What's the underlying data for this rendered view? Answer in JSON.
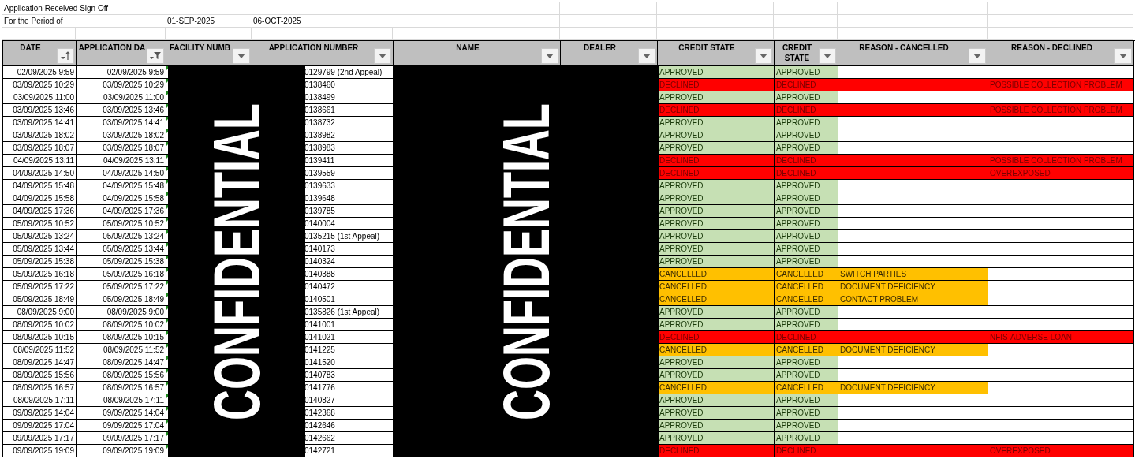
{
  "title": "Application Received Sign Off",
  "period": {
    "label": "For the Period of",
    "from": "01-SEP-2025",
    "to": "06-OCT-2025"
  },
  "columns": [
    {
      "label": "DATE",
      "kind": "sort"
    },
    {
      "label": "APPLICATION DA",
      "kind": "filter"
    },
    {
      "label": "FACILITY NUMB",
      "kind": "dropdown"
    },
    {
      "label": "APPLICATION NUMBER",
      "kind": "dropdown"
    },
    {
      "label": "NAME",
      "kind": "dropdown"
    },
    {
      "label": "DEALER",
      "kind": "dropdown"
    },
    {
      "label": "CREDIT STATE",
      "kind": "dropdown"
    },
    {
      "label": "CREDIT STATE",
      "kind": "dropdown"
    },
    {
      "label": "REASON  - CANCELLED",
      "kind": "dropdown"
    },
    {
      "label": "REASON - DECLINED",
      "kind": "dropdown"
    }
  ],
  "redactions": [
    "CONFIDENTIAL",
    "CONFIDENTIAL"
  ],
  "rows": [
    {
      "date": "02/09/2025 9:59",
      "application_date": "02/09/2025 9:59",
      "application_number": "0129799 (2nd Appeal)",
      "kind": "approved",
      "credit_state": "APPROVED",
      "credit_state_2": "APPROVED",
      "reason_cancelled": "",
      "reason_declined": ""
    },
    {
      "date": "03/09/2025 10:29",
      "application_date": "03/09/2025 10:29",
      "application_number": "0138460",
      "kind": "declined",
      "credit_state": "DECLINED",
      "credit_state_2": "DECLINED",
      "reason_cancelled": "",
      "reason_declined": "POSSIBLE COLLECTION PROBLEM"
    },
    {
      "date": "03/09/2025 11:00",
      "application_date": "03/09/2025 11:00",
      "application_number": "0138499",
      "kind": "approved",
      "credit_state": "APPROVED",
      "credit_state_2": "APPROVED",
      "reason_cancelled": "",
      "reason_declined": ""
    },
    {
      "date": "03/09/2025 13:46",
      "application_date": "03/09/2025 13:46",
      "application_number": "0138661",
      "kind": "declined",
      "credit_state": "DECLINED",
      "credit_state_2": "DECLINED",
      "reason_cancelled": "",
      "reason_declined": "POSSIBLE COLLECTION PROBLEM"
    },
    {
      "date": "03/09/2025 14:41",
      "application_date": "03/09/2025 14:41",
      "application_number": "0138732",
      "kind": "approved",
      "credit_state": "APPROVED",
      "credit_state_2": "APPROVED",
      "reason_cancelled": "",
      "reason_declined": ""
    },
    {
      "date": "03/09/2025 18:02",
      "application_date": "03/09/2025 18:02",
      "application_number": "0138982",
      "kind": "approved",
      "credit_state": "APPROVED",
      "credit_state_2": "APPROVED",
      "reason_cancelled": "",
      "reason_declined": ""
    },
    {
      "date": "03/09/2025 18:07",
      "application_date": "03/09/2025 18:07",
      "application_number": "0138983",
      "kind": "approved",
      "credit_state": "APPROVED",
      "credit_state_2": "APPROVED",
      "reason_cancelled": "",
      "reason_declined": ""
    },
    {
      "date": "04/09/2025 13:11",
      "application_date": "04/09/2025 13:11",
      "application_number": "0139411",
      "kind": "declined",
      "credit_state": "DECLINED",
      "credit_state_2": "DECLINED",
      "reason_cancelled": "",
      "reason_declined": "POSSIBLE COLLECTION PROBLEM"
    },
    {
      "date": "04/09/2025 14:50",
      "application_date": "04/09/2025 14:50",
      "application_number": "0139559",
      "kind": "declined",
      "credit_state": "DECLINED",
      "credit_state_2": "DECLINED",
      "reason_cancelled": "",
      "reason_declined": "OVEREXPOSED"
    },
    {
      "date": "04/09/2025 15:48",
      "application_date": "04/09/2025 15:48",
      "application_number": "0139633",
      "kind": "approved",
      "credit_state": "APPROVED",
      "credit_state_2": "APPROVED",
      "reason_cancelled": "",
      "reason_declined": ""
    },
    {
      "date": "04/09/2025 15:58",
      "application_date": "04/09/2025 15:58",
      "application_number": "0139648",
      "kind": "approved",
      "credit_state": "APPROVED",
      "credit_state_2": "APPROVED",
      "reason_cancelled": "",
      "reason_declined": ""
    },
    {
      "date": "04/09/2025 17:36",
      "application_date": "04/09/2025 17:36",
      "application_number": "0139785",
      "kind": "approved",
      "credit_state": "APPROVED",
      "credit_state_2": "APPROVED",
      "reason_cancelled": "",
      "reason_declined": ""
    },
    {
      "date": "05/09/2025 10:52",
      "application_date": "05/09/2025 10:52",
      "application_number": "0140004",
      "kind": "approved",
      "credit_state": "APPROVED",
      "credit_state_2": "APPROVED",
      "reason_cancelled": "",
      "reason_declined": ""
    },
    {
      "date": "05/09/2025 13:24",
      "application_date": "05/09/2025 13:24",
      "application_number": "0135215 (1st Appeal)",
      "kind": "approved",
      "credit_state": "APPROVED",
      "credit_state_2": "APPROVED",
      "reason_cancelled": "",
      "reason_declined": ""
    },
    {
      "date": "05/09/2025 13:44",
      "application_date": "05/09/2025 13:44",
      "application_number": "0140173",
      "kind": "approved",
      "credit_state": "APPROVED",
      "credit_state_2": "APPROVED",
      "reason_cancelled": "",
      "reason_declined": ""
    },
    {
      "date": "05/09/2025 15:38",
      "application_date": "05/09/2025 15:38",
      "application_number": "0140324",
      "kind": "approved",
      "credit_state": "APPROVED",
      "credit_state_2": "APPROVED",
      "reason_cancelled": "",
      "reason_declined": ""
    },
    {
      "date": "05/09/2025 16:18",
      "application_date": "05/09/2025 16:18",
      "application_number": "0140388",
      "kind": "cancelled",
      "credit_state": "CANCELLED",
      "credit_state_2": "CANCELLED",
      "reason_cancelled": "SWITCH PARTIES",
      "reason_declined": ""
    },
    {
      "date": "05/09/2025 17:22",
      "application_date": "05/09/2025 17:22",
      "application_number": "0140472",
      "kind": "cancelled",
      "credit_state": "CANCELLED",
      "credit_state_2": "CANCELLED",
      "reason_cancelled": "DOCUMENT DEFICIENCY",
      "reason_declined": ""
    },
    {
      "date": "05/09/2025 18:49",
      "application_date": "05/09/2025 18:49",
      "application_number": "0140501",
      "kind": "cancelled",
      "credit_state": "CANCELLED",
      "credit_state_2": "CANCELLED",
      "reason_cancelled": "CONTACT PROBLEM",
      "reason_declined": ""
    },
    {
      "date": "08/09/2025 9:00",
      "application_date": "08/09/2025 9:00",
      "application_number": "0135826 (1st Appeal)",
      "kind": "approved",
      "credit_state": "APPROVED",
      "credit_state_2": "APPROVED",
      "reason_cancelled": "",
      "reason_declined": ""
    },
    {
      "date": "08/09/2025 10:02",
      "application_date": "08/09/2025 10:02",
      "application_number": "0141001",
      "kind": "approved",
      "credit_state": "APPROVED",
      "credit_state_2": "APPROVED",
      "reason_cancelled": "",
      "reason_declined": ""
    },
    {
      "date": "08/09/2025 10:15",
      "application_date": "08/09/2025 10:15",
      "application_number": "0141021",
      "kind": "declined",
      "credit_state": "DECLINED",
      "credit_state_2": "DECLINED",
      "reason_cancelled": "",
      "reason_declined": "NFIS-ADVERSE LOAN"
    },
    {
      "date": "08/09/2025 11:52",
      "application_date": "08/09/2025 11:52",
      "application_number": "0141225",
      "kind": "cancelled",
      "credit_state": "CANCELLED",
      "credit_state_2": "CANCELLED",
      "reason_cancelled": "DOCUMENT DEFICIENCY",
      "reason_declined": ""
    },
    {
      "date": "08/09/2025 14:47",
      "application_date": "08/09/2025 14:47",
      "application_number": "0141520",
      "kind": "approved",
      "credit_state": "APPROVED",
      "credit_state_2": "APPROVED",
      "reason_cancelled": "",
      "reason_declined": ""
    },
    {
      "date": "08/09/2025 15:56",
      "application_date": "08/09/2025 15:56",
      "application_number": "0140783",
      "kind": "approved",
      "credit_state": "APPROVED",
      "credit_state_2": "APPROVED",
      "reason_cancelled": "",
      "reason_declined": ""
    },
    {
      "date": "08/09/2025 16:57",
      "application_date": "08/09/2025 16:57",
      "application_number": "0141776",
      "kind": "cancelled",
      "credit_state": "CANCELLED",
      "credit_state_2": "CANCELLED",
      "reason_cancelled": "DOCUMENT DEFICIENCY",
      "reason_declined": ""
    },
    {
      "date": "08/09/2025 17:11",
      "application_date": "08/09/2025 17:11",
      "application_number": "0140827",
      "kind": "approved",
      "credit_state": "APPROVED",
      "credit_state_2": "APPROVED",
      "reason_cancelled": "",
      "reason_declined": ""
    },
    {
      "date": "09/09/2025 14:04",
      "application_date": "09/09/2025 14:04",
      "application_number": "0142368",
      "kind": "approved",
      "credit_state": "APPROVED",
      "credit_state_2": "APPROVED",
      "reason_cancelled": "",
      "reason_declined": ""
    },
    {
      "date": "09/09/2025 17:04",
      "application_date": "09/09/2025 17:04",
      "application_number": "0142646",
      "kind": "approved",
      "credit_state": "APPROVED",
      "credit_state_2": "APPROVED",
      "reason_cancelled": "",
      "reason_declined": ""
    },
    {
      "date": "09/09/2025 17:17",
      "application_date": "09/09/2025 17:17",
      "application_number": "0142662",
      "kind": "approved",
      "credit_state": "APPROVED",
      "credit_state_2": "APPROVED",
      "reason_cancelled": "",
      "reason_declined": ""
    },
    {
      "date": "09/09/2025 19:09",
      "application_date": "09/09/2025 19:09",
      "application_number": "0142721",
      "kind": "declined",
      "credit_state": "DECLINED",
      "credit_state_2": "DECLINED",
      "reason_cancelled": "",
      "reason_declined": "OVEREXPOSED"
    }
  ]
}
